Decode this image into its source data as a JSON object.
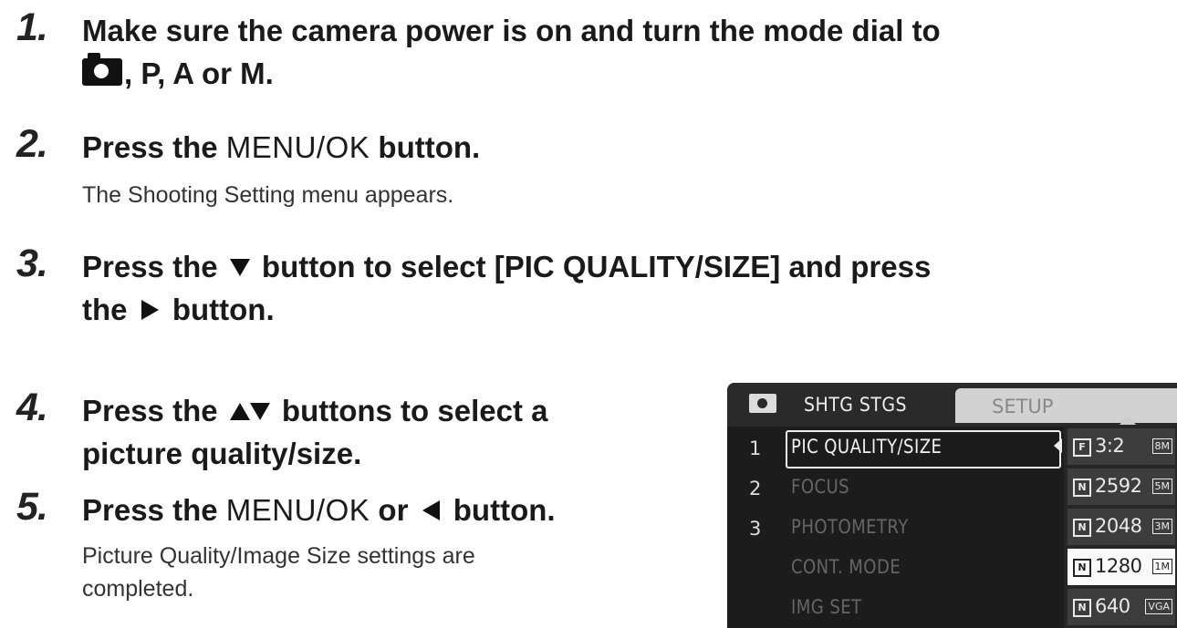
{
  "steps": [
    {
      "num": "1.",
      "line1": "Make sure the camera power is on and turn the mode dial to",
      "line2": ", P, A or M."
    },
    {
      "num": "2.",
      "pre": "Press the ",
      "menuok": "MENU/OK",
      "post": " button.",
      "sub": "The Shooting Setting menu appears."
    },
    {
      "num": "3.",
      "pre": "Press the ",
      "mid": " button to select [PIC QUALITY/SIZE] and press",
      "line2pre": "the ",
      "line2post": " button."
    },
    {
      "num": "4.",
      "pre": "Press the ",
      "post": " buttons to select a",
      "line2": "picture quality/size."
    },
    {
      "num": "5.",
      "pre": "Press the ",
      "menuok": "MENU/OK",
      "mid": " or ",
      "post": " button.",
      "sub1": "Picture Quality/Image Size settings are",
      "sub2": "completed."
    }
  ],
  "icons": {
    "mode_icon": "camera-icon",
    "down": "down-triangle-icon",
    "up": "up-triangle-icon",
    "right": "right-triangle-icon",
    "left": "left-triangle-icon"
  },
  "lcd": {
    "tab_shooting": "SHTG STGS",
    "tab_setup": "SETUP",
    "rows": [
      {
        "num": "1",
        "label": "PIC QUALITY/SIZE"
      },
      {
        "num": "2",
        "label": "FOCUS"
      },
      {
        "num": "3",
        "label": "PHOTOMETRY"
      },
      {
        "num": "",
        "label": "CONT. MODE"
      },
      {
        "num": "",
        "label": "IMG SET"
      }
    ],
    "submenu": [
      {
        "q": "F",
        "value": "3:2",
        "size": "8M"
      },
      {
        "q": "N",
        "value": "2592",
        "size": "5M"
      },
      {
        "q": "N",
        "value": "2048",
        "size": "3M"
      },
      {
        "q": "N",
        "value": "1280",
        "size": "1M"
      },
      {
        "q": "N",
        "value": "640",
        "size": "VGA"
      }
    ],
    "selected_submenu_index": 3,
    "colors": {
      "screen": "#1c1c1c",
      "highlight": "#fafafa"
    }
  }
}
